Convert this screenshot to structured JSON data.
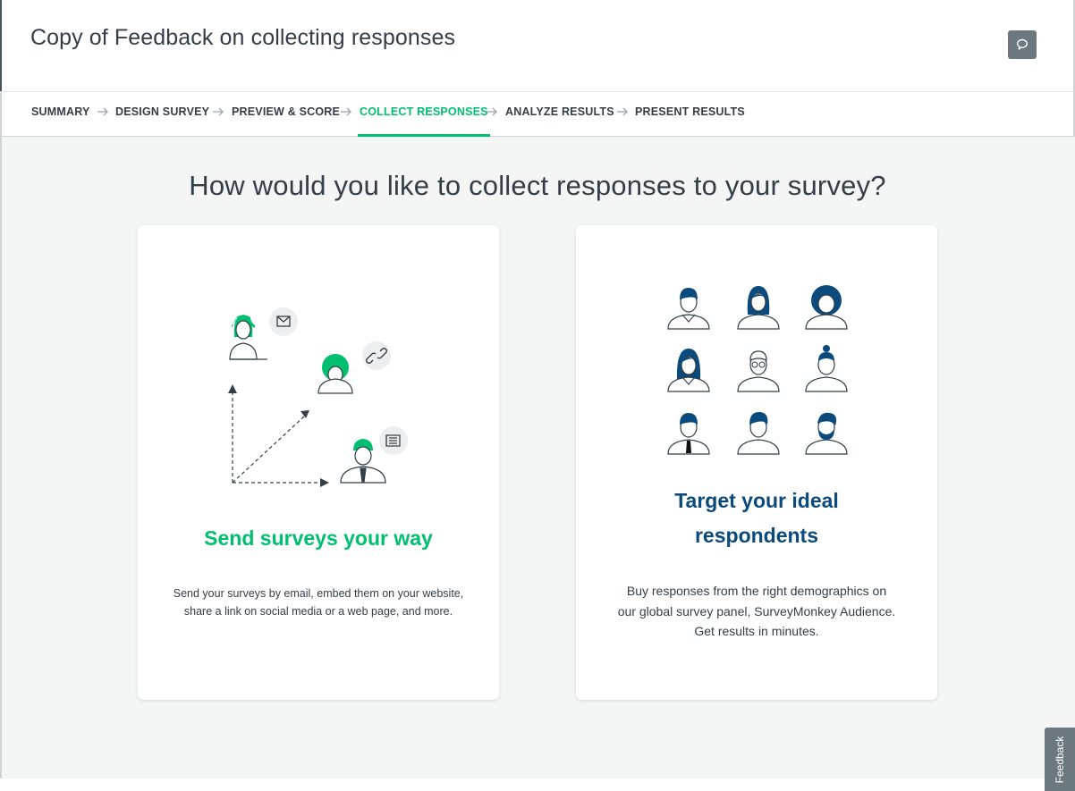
{
  "header": {
    "title": "Copy of Feedback on collecting responses",
    "comment_icon": "speech-bubble-icon"
  },
  "nav": {
    "items": [
      {
        "label": "SUMMARY",
        "active": false
      },
      {
        "label": "DESIGN SURVEY",
        "active": false
      },
      {
        "label": "PREVIEW & SCORE",
        "active": false
      },
      {
        "label": "COLLECT RESPONSES",
        "active": true
      },
      {
        "label": "ANALYZE RESULTS",
        "active": false
      },
      {
        "label": "PRESENT RESULTS",
        "active": false
      }
    ],
    "separator_icon": "arrow-right-icon"
  },
  "main": {
    "question": "How would you like to collect responses to your survey?"
  },
  "cards": {
    "send": {
      "heading": "Send surveys your way",
      "desc_line1": "Send your surveys by email, embed them on your website,",
      "desc_line2": "share a link on social media or a web page, and more.",
      "icons": [
        "email-icon",
        "link-icon",
        "web-page-icon"
      ]
    },
    "target": {
      "heading_line1": "Target your ideal",
      "heading_line2": "respondents",
      "desc_line1": "Buy responses from the right demographics on",
      "desc_line2": "our global survey panel, SurveyMonkey Audience.",
      "desc_line3": "Get results in minutes."
    }
  },
  "feedback_tab": {
    "label": "Feedback"
  },
  "colors": {
    "brand_green": "#00bf6f",
    "navy": "#0a4a7c",
    "text": "#333e48",
    "gray_button": "#6b787f",
    "background": "#f4f5f5"
  }
}
